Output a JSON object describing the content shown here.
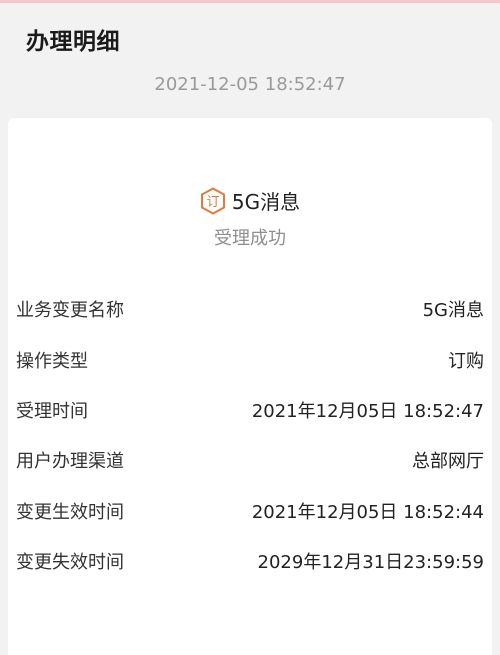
{
  "header": {
    "title": "办理明细",
    "timestamp": "2021-12-05 18:52:47"
  },
  "service": {
    "icon": "subscribe-hexagon-icon",
    "icon_glyph": "订",
    "icon_color": "#e07b39",
    "name": "5G消息",
    "status": "受理成功"
  },
  "details": [
    {
      "label": "业务变更名称",
      "value": "5G消息"
    },
    {
      "label": "操作类型",
      "value": "订购"
    },
    {
      "label": "受理时间",
      "value": "2021年12月05日 18:52:47"
    },
    {
      "label": "用户办理渠道",
      "value": "总部网厅"
    },
    {
      "label": "变更生效时间",
      "value": "2021年12月05日 18:52:44"
    },
    {
      "label": "变更失效时间",
      "value": "2029年12月31日23:59:59"
    }
  ]
}
